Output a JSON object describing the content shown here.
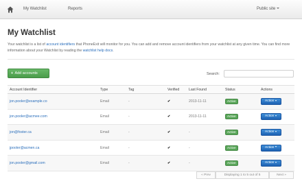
{
  "navbar": {
    "home_icon": "home-icon",
    "items": [
      "My Watchlist",
      "Reports"
    ],
    "public_site": "Public site"
  },
  "page": {
    "title": "My Watchlist",
    "intro": {
      "part1": "Your watchlist is a list of ",
      "link1": "account identifiers",
      "part2": " that PhoneExit will monitor for you. You can add and remove account identifiers from your watchlist at any given time. You can find more information about your Watchlist by reading the ",
      "link2": "watchlist help docs",
      "part3": "."
    }
  },
  "toolbar": {
    "add_label": "Add accounts",
    "search_label": "Search:",
    "search_value": ""
  },
  "table": {
    "headers": [
      "Account Identifier",
      "Type",
      "Tag",
      "Verified",
      "Last Found",
      "Status",
      "Actions"
    ],
    "rows": [
      {
        "identifier": "jon.pooler@example.co",
        "type": "Email",
        "tag": "-",
        "verified": "✔",
        "last_found": "2013-11-11",
        "status": "Active",
        "action": "Action"
      },
      {
        "identifier": "jon.pooler@acmee.com",
        "type": "Email",
        "tag": "-",
        "verified": "✔",
        "last_found": "2013-11-11",
        "status": "Active",
        "action": "Action"
      },
      {
        "identifier": "jon@foster.ca",
        "type": "Email",
        "tag": "-",
        "verified": "✔",
        "last_found": "-",
        "status": "Active",
        "action": "Action"
      },
      {
        "identifier": "jpooler@acmen.ca",
        "type": "Email",
        "tag": "-",
        "verified": "✔",
        "last_found": "-",
        "status": "Active",
        "action": "Action"
      },
      {
        "identifier": "jon.pooler@gmail.com",
        "type": "Email",
        "tag": "-",
        "verified": "✔",
        "last_found": "-",
        "status": "Active",
        "action": "Action"
      }
    ]
  },
  "pagination": {
    "prev": "« Prev",
    "info": "Displaying 1 to 5 out of 5",
    "next": "Next »"
  },
  "colors": {
    "accent_blue": "#2a6ebb",
    "button_green": "#5aa65a",
    "action_blue": "#1d62b3"
  }
}
